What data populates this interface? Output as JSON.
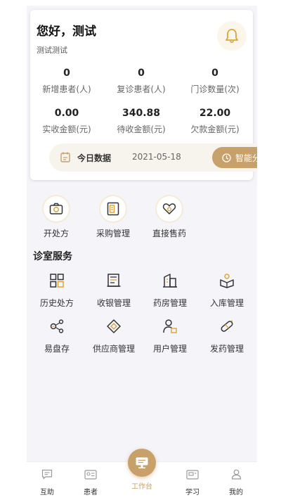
{
  "header": {
    "greeting": "您好，测试",
    "subtitle": "测试测试",
    "bell_icon": "bell-icon"
  },
  "stats": [
    {
      "value": "0",
      "label": "新增患者(人)"
    },
    {
      "value": "0",
      "label": "复诊患者(人)"
    },
    {
      "value": "0",
      "label": "门诊数量(次)"
    },
    {
      "value": "0.00",
      "label": "实收金额(元)"
    },
    {
      "value": "340.88",
      "label": "待收金额(元)"
    },
    {
      "value": "22.00",
      "label": "欠款金额(元)"
    }
  ],
  "today": {
    "label": "今日数据",
    "date": "2021-05-18",
    "ai_button": "智能分析"
  },
  "quick_actions": [
    {
      "label": "开处方",
      "icon": "camera-prescription-icon"
    },
    {
      "label": "采购管理",
      "icon": "purchase-icon"
    },
    {
      "label": "直接售药",
      "icon": "heart-pill-icon"
    }
  ],
  "services": {
    "title": "诊室服务",
    "items": [
      {
        "label": "历史处方",
        "icon": "grid-icon"
      },
      {
        "label": "收银管理",
        "icon": "cashier-icon"
      },
      {
        "label": "药房管理",
        "icon": "building-icon"
      },
      {
        "label": "入库管理",
        "icon": "inbound-icon"
      },
      {
        "label": "易盘存",
        "icon": "inventory-icon"
      },
      {
        "label": "供应商管理",
        "icon": "supplier-icon"
      },
      {
        "label": "用户管理",
        "icon": "user-icon"
      },
      {
        "label": "发药管理",
        "icon": "capsule-icon"
      }
    ]
  },
  "tabbar": [
    {
      "label": "互助",
      "icon": "chat-icon"
    },
    {
      "label": "患者",
      "icon": "id-card-icon"
    },
    {
      "label": "工作台",
      "icon": "monitor-icon"
    },
    {
      "label": "学习",
      "icon": "study-icon"
    },
    {
      "label": "我的",
      "icon": "person-icon"
    }
  ],
  "colors": {
    "accent": "#c8a06a",
    "background": "#f5f4f8"
  }
}
